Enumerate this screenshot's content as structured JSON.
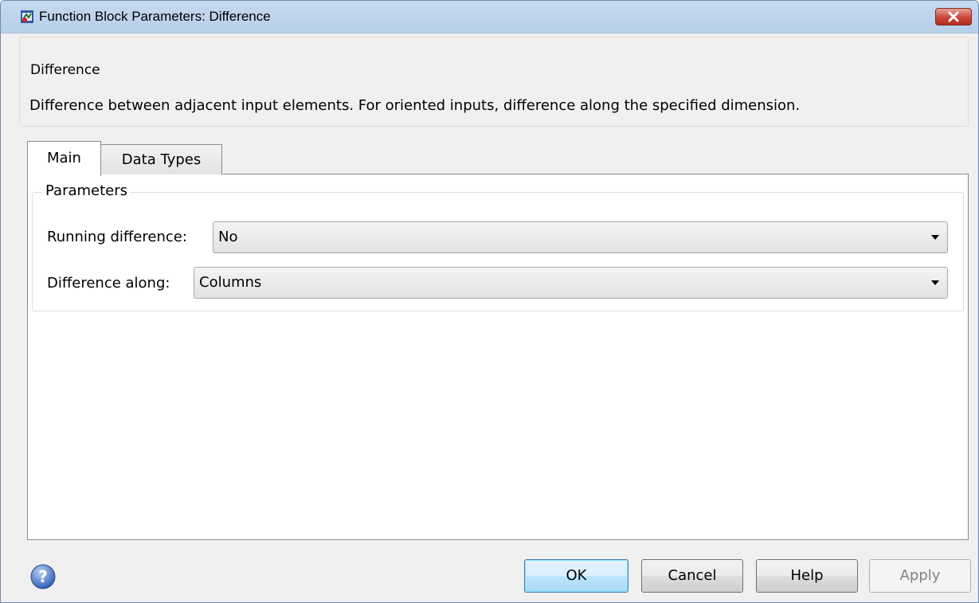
{
  "window": {
    "title": "Function Block Parameters: Difference"
  },
  "description": {
    "group_title": "Difference",
    "text": "Difference between adjacent input elements.  For oriented inputs, difference along the specified dimension."
  },
  "tabs": [
    {
      "label": "Main",
      "selected": true
    },
    {
      "label": "Data Types",
      "selected": false
    }
  ],
  "parameters": {
    "group_title": "Parameters",
    "running_difference": {
      "label": "Running difference:",
      "value": "No"
    },
    "difference_along": {
      "label": "Difference along:",
      "value": "Columns"
    }
  },
  "buttons": {
    "ok": "OK",
    "cancel": "Cancel",
    "help": "Help",
    "apply": "Apply"
  },
  "icons": {
    "window_icon": "simulink-block-icon",
    "close": "close-icon",
    "help": "help-icon"
  },
  "colors": {
    "titlebar": "#c6d9ee",
    "close_button": "#c8473a",
    "default_button": "#3c7fb1"
  }
}
